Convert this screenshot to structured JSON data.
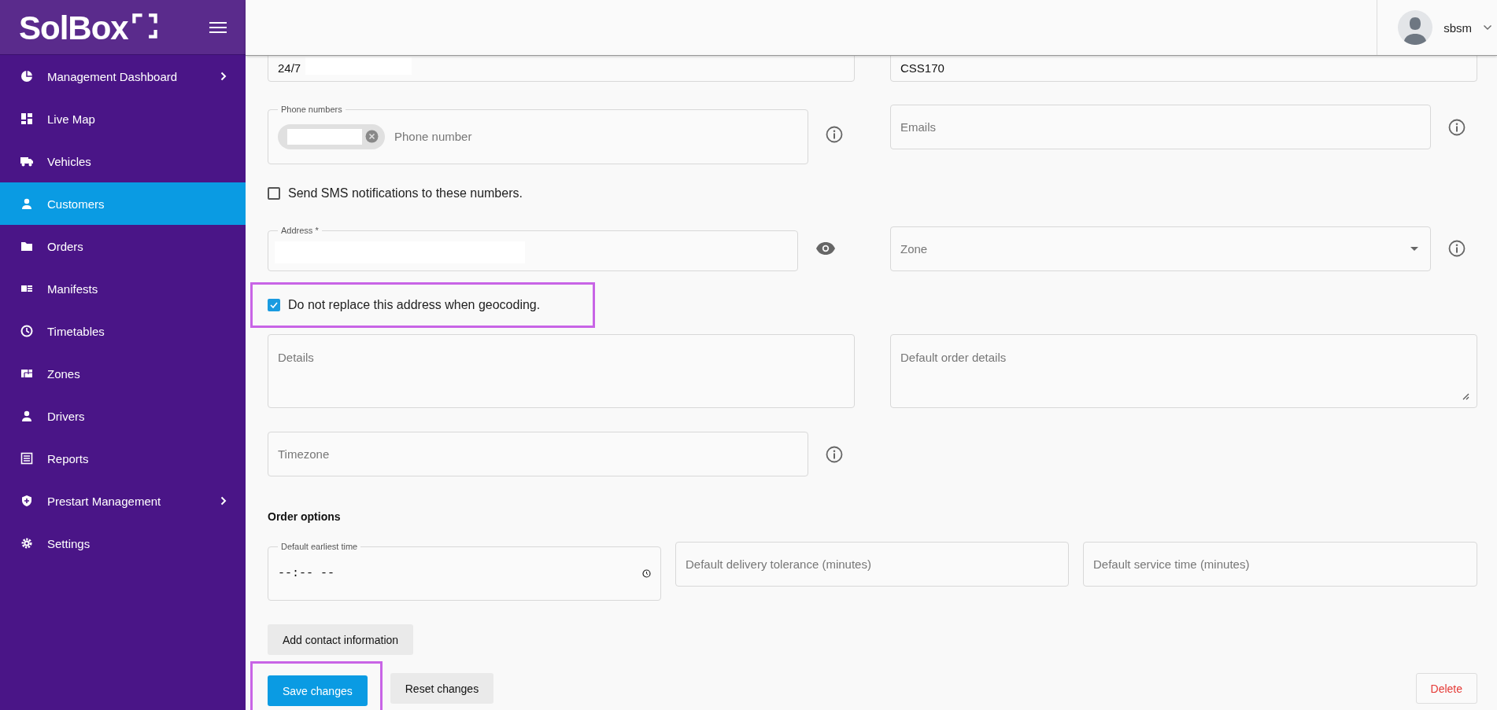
{
  "sidebar": {
    "logo": "SolBox",
    "items": [
      {
        "label": "Management Dashboard",
        "selected": false,
        "has_submenu": true
      },
      {
        "label": "Live Map",
        "selected": false,
        "has_submenu": false
      },
      {
        "label": "Vehicles",
        "selected": false,
        "has_submenu": false
      },
      {
        "label": "Customers",
        "selected": true,
        "has_submenu": false
      },
      {
        "label": "Orders",
        "selected": false,
        "has_submenu": false
      },
      {
        "label": "Manifests",
        "selected": false,
        "has_submenu": false
      },
      {
        "label": "Timetables",
        "selected": false,
        "has_submenu": false
      },
      {
        "label": "Zones",
        "selected": false,
        "has_submenu": false
      },
      {
        "label": "Drivers",
        "selected": false,
        "has_submenu": false
      },
      {
        "label": "Reports",
        "selected": false,
        "has_submenu": false
      },
      {
        "label": "Prestart Management",
        "selected": false,
        "has_submenu": true
      },
      {
        "label": "Settings",
        "selected": false,
        "has_submenu": false
      }
    ]
  },
  "header": {
    "user": "sbsm"
  },
  "form": {
    "top_left_value": "24/7",
    "top_right_value": "CSS170",
    "phone_numbers": {
      "label": "Phone numbers",
      "placeholder": "Phone number"
    },
    "emails": {
      "placeholder": "Emails"
    },
    "sms_notifications": {
      "label": "Send SMS notifications to these numbers.",
      "checked": false
    },
    "address": {
      "label": "Address *"
    },
    "zone": {
      "placeholder": "Zone"
    },
    "no_replace_geocoding": {
      "label": "Do not replace this address when geocoding.",
      "checked": true,
      "highlighted": true
    },
    "details": {
      "placeholder": "Details"
    },
    "default_order_details": {
      "placeholder": "Default order details"
    },
    "timezone": {
      "placeholder": "Timezone"
    },
    "order_options": {
      "title": "Order options",
      "earliest_time": {
        "label": "Default earliest time",
        "value": "--:-- --"
      },
      "delivery_tolerance": {
        "placeholder": "Default delivery tolerance (minutes)"
      },
      "service_time": {
        "placeholder": "Default service time (minutes)"
      }
    },
    "add_contact_button": "Add contact information",
    "buttons": [
      {
        "label": "Save changes",
        "kind": "primary",
        "highlighted": true
      },
      {
        "label": "Reset changes",
        "kind": "secondary",
        "highlighted": false
      },
      {
        "label": "Delete",
        "kind": "danger",
        "highlighted": false
      }
    ]
  }
}
